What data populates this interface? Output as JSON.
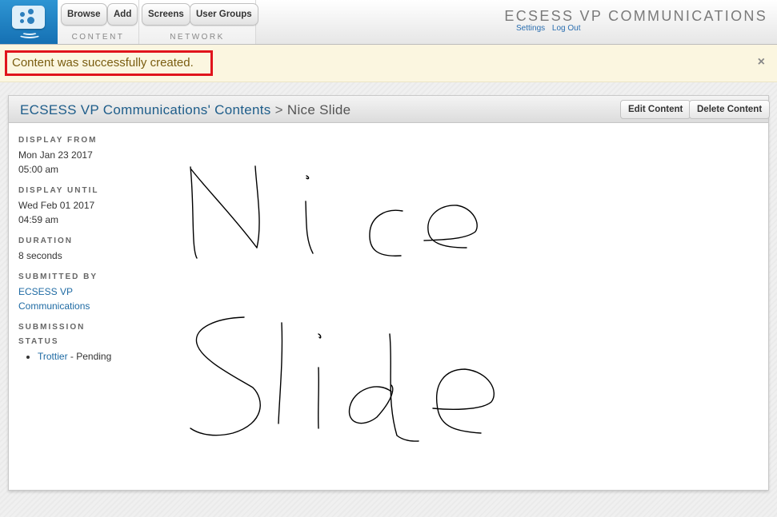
{
  "nav": {
    "content": {
      "label": "CONTENT",
      "buttons": [
        "Browse",
        "Add"
      ]
    },
    "network": {
      "label": "NETWORK",
      "buttons": [
        "Screens",
        "User Groups"
      ]
    }
  },
  "site": {
    "title": "ECSESS VP COMMUNICATIONS",
    "links": [
      "Settings",
      "Log Out"
    ]
  },
  "flash": {
    "message": "Content was successfully created.",
    "close": "×"
  },
  "panel": {
    "breadcrumb_link": "ECSESS VP Communications' Contents",
    "breadcrumb_sep": ">",
    "breadcrumb_current": "Nice Slide",
    "edit_label": "Edit Content",
    "delete_label": "Delete Content"
  },
  "details": {
    "display_from_label": "DISPLAY FROM",
    "display_from_date": "Mon Jan 23 2017",
    "display_from_time": "05:00 am",
    "display_until_label": "DISPLAY UNTIL",
    "display_until_date": "Wed Feb 01 2017",
    "display_until_time": "04:59 am",
    "duration_label": "DURATION",
    "duration_value": "8 seconds",
    "submitted_by_label": "SUBMITTED BY",
    "submitted_by_line1": "ECSESS VP",
    "submitted_by_line2": "Communications",
    "submission_label_1": "SUBMISSION",
    "submission_label_2": "STATUS",
    "submission_screen": "Trottier",
    "submission_state": " - Pending"
  },
  "slide_image": {
    "handwritten_text": "Nice Slide",
    "stroke_color": "#000000"
  },
  "colors": {
    "accent": "#1e5d8a",
    "flash_bg": "#fbf6e0",
    "flash_border": "#e0141c"
  }
}
